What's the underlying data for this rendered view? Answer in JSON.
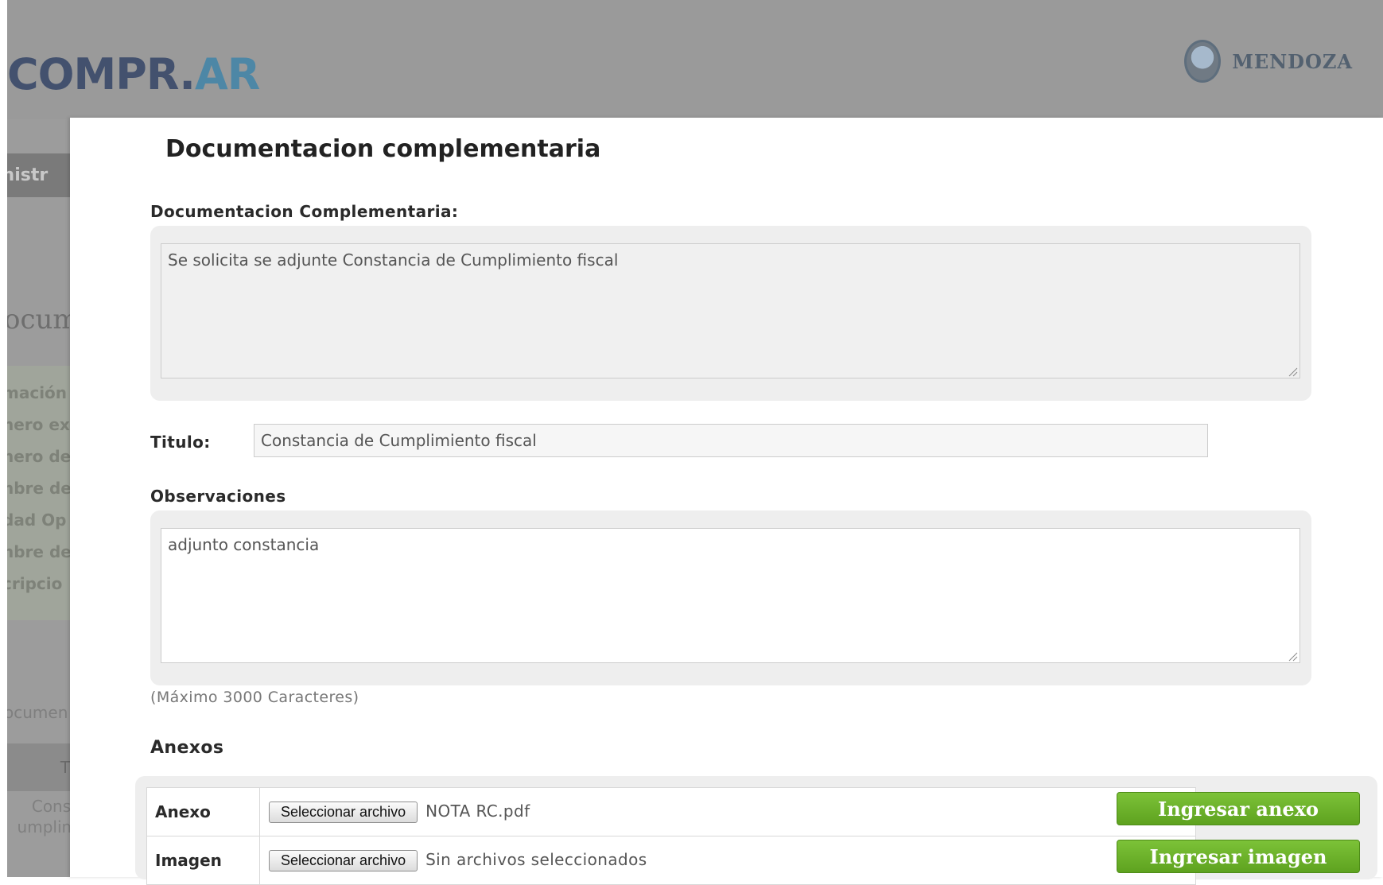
{
  "header": {
    "logo_part1": "COMPR.",
    "logo_part2": "AR",
    "brand_name": "MENDOZA"
  },
  "background": {
    "tab_label": "inistr",
    "heading": "ocum",
    "list_items": [
      "mación",
      "nero ex",
      "nero de",
      "nbre de",
      "dad Op",
      "nbre de",
      "cripcio"
    ],
    "subheading": "ocumen",
    "table_header": "Ti",
    "row_text_1": "Const",
    "row_text_2": "umplim"
  },
  "modal": {
    "title": "Documentacion complementaria",
    "doc_label": "Documentacion Complementaria:",
    "doc_value": "Se solicita se adjunte Constancia de Cumplimiento fiscal",
    "titulo_label": "Titulo:",
    "titulo_value": "Constancia de Cumplimiento fiscal",
    "obs_label": "Observaciones",
    "obs_value": "adjunto constancia",
    "max_hint": "(Máximo 3000 Caracteres)",
    "annexes_label": "Anexos",
    "annex": {
      "label": "Anexo",
      "file_button": "Seleccionar archivo",
      "file_name": "NOTA RC.pdf",
      "submit": "Ingresar anexo"
    },
    "image": {
      "label": "Imagen",
      "file_button": "Seleccionar archivo",
      "file_name": "Sin archivos seleccionados",
      "submit": "Ingresar imagen"
    }
  },
  "colors": {
    "accent_green": "#6cb22b",
    "logo_dark": "#43516e",
    "logo_light": "#4d87a6"
  }
}
